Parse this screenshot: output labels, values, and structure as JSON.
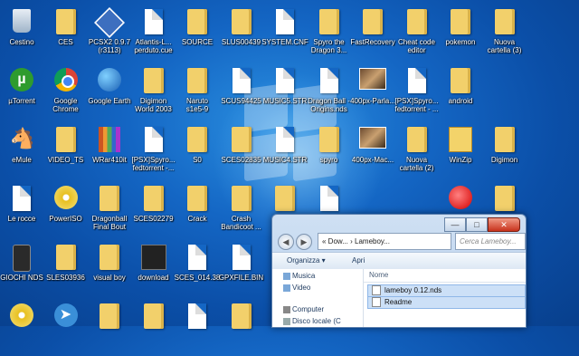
{
  "desktop": {
    "icons": [
      {
        "label": "Cestino",
        "kind": "bin",
        "col": 0,
        "row": 0
      },
      {
        "label": "CES",
        "kind": "folder",
        "col": 1,
        "row": 0
      },
      {
        "label": "PCSX2 0.9.7\n(r3113)",
        "kind": "blueapp",
        "col": 2,
        "row": 0
      },
      {
        "label": "Atlantis-L...\nperduto.cue",
        "kind": "file",
        "col": 3,
        "row": 0
      },
      {
        "label": "SOURCE",
        "kind": "folder",
        "col": 4,
        "row": 0
      },
      {
        "label": "SLUS00439",
        "kind": "folder",
        "col": 5,
        "row": 0
      },
      {
        "label": "SYSTEM.CNF",
        "kind": "file",
        "col": 6,
        "row": 0
      },
      {
        "label": "Spyro the\nDragon 3...",
        "kind": "folder",
        "col": 7,
        "row": 0
      },
      {
        "label": "FastRecovery",
        "kind": "folder",
        "col": 8,
        "row": 0
      },
      {
        "label": "Cheat code\neditor",
        "kind": "folder",
        "col": 9,
        "row": 0
      },
      {
        "label": "pokemon",
        "kind": "folder",
        "col": 10,
        "row": 0
      },
      {
        "label": "Nuova\ncartella (3)",
        "kind": "folder",
        "col": 11,
        "row": 0
      },
      {
        "label": "µTorrent",
        "kind": "utorrent",
        "col": 0,
        "row": 1
      },
      {
        "label": "Google\nChrome",
        "kind": "chrome",
        "col": 1,
        "row": 1
      },
      {
        "label": "Google Earth",
        "kind": "globe",
        "col": 2,
        "row": 1
      },
      {
        "label": "Digimon\nWorld 2003",
        "kind": "folder",
        "col": 3,
        "row": 1
      },
      {
        "label": "Naruto\ns1e5-9",
        "kind": "folder",
        "col": 4,
        "row": 1
      },
      {
        "label": "SCUS94425",
        "kind": "file",
        "col": 5,
        "row": 1
      },
      {
        "label": "MUSIC5.STR",
        "kind": "file",
        "col": 6,
        "row": 1
      },
      {
        "label": "Dragon Ball -\nOrigins.nds",
        "kind": "file",
        "col": 7,
        "row": 1
      },
      {
        "label": "400px-Parla...",
        "kind": "thumb",
        "col": 8,
        "row": 1
      },
      {
        "label": "[PSX]Spyro...\nfedtorrent - ...",
        "kind": "file",
        "col": 9,
        "row": 1
      },
      {
        "label": "android",
        "kind": "folder",
        "col": 10,
        "row": 1
      },
      {
        "label": "eMule",
        "kind": "mule",
        "col": 0,
        "row": 2
      },
      {
        "label": "VIDEO_TS",
        "kind": "folder",
        "col": 1,
        "row": 2
      },
      {
        "label": "WRar410it",
        "kind": "stack",
        "col": 2,
        "row": 2
      },
      {
        "label": "[PSX]Spyro...\nfedtorrent -...",
        "kind": "file",
        "col": 3,
        "row": 2
      },
      {
        "label": "S0",
        "kind": "folder",
        "col": 4,
        "row": 2
      },
      {
        "label": "SCES02835",
        "kind": "folder",
        "col": 5,
        "row": 2
      },
      {
        "label": "MUSIC4.STR",
        "kind": "file",
        "col": 6,
        "row": 2
      },
      {
        "label": "spyro",
        "kind": "folder",
        "col": 7,
        "row": 2
      },
      {
        "label": "400px-Mac...",
        "kind": "thumb",
        "col": 8,
        "row": 2
      },
      {
        "label": "Nuova\ncartella (2)",
        "kind": "folder",
        "col": 9,
        "row": 2
      },
      {
        "label": "WinZip",
        "kind": "zip",
        "col": 10,
        "row": 2
      },
      {
        "label": "Digimon",
        "kind": "folder",
        "col": 11,
        "row": 2
      },
      {
        "label": "Le rocce",
        "kind": "file",
        "col": 0,
        "row": 3
      },
      {
        "label": "PowerISO",
        "kind": "disc",
        "col": 1,
        "row": 3
      },
      {
        "label": "Dragonball\nFinal Bout",
        "kind": "folder",
        "col": 2,
        "row": 3
      },
      {
        "label": "SCES02279",
        "kind": "folder",
        "col": 3,
        "row": 3
      },
      {
        "label": "Crack",
        "kind": "folder",
        "col": 4,
        "row": 3
      },
      {
        "label": "Crash\nBandicoot ...",
        "kind": "folder",
        "col": 5,
        "row": 3
      },
      {
        "label": "",
        "kind": "folder",
        "col": 6,
        "row": 3
      },
      {
        "label": "",
        "kind": "file",
        "col": 7,
        "row": 3
      },
      {
        "label": "",
        "kind": "redball",
        "col": 10,
        "row": 3
      },
      {
        "label": "",
        "kind": "folder",
        "col": 11,
        "row": 3
      },
      {
        "label": "GIOCHI NDS",
        "kind": "device",
        "col": 0,
        "row": 4
      },
      {
        "label": "SLES03936",
        "kind": "folder",
        "col": 1,
        "row": 4
      },
      {
        "label": "visual boy",
        "kind": "folder",
        "col": 2,
        "row": 4
      },
      {
        "label": "download",
        "kind": "dark",
        "col": 3,
        "row": 4
      },
      {
        "label": "SCES_014.38",
        "kind": "file",
        "col": 4,
        "row": 4
      },
      {
        "label": "GPXFILE.BIN",
        "kind": "file",
        "col": 5,
        "row": 4
      },
      {
        "label": "",
        "kind": "file",
        "col": 6,
        "row": 4
      },
      {
        "label": "",
        "kind": "disc",
        "col": 0,
        "row": 5
      },
      {
        "label": "",
        "kind": "speed",
        "col": 1,
        "row": 5
      },
      {
        "label": "",
        "kind": "folder",
        "col": 2,
        "row": 5
      },
      {
        "label": "",
        "kind": "folder",
        "col": 3,
        "row": 5
      },
      {
        "label": "",
        "kind": "file",
        "col": 4,
        "row": 5
      },
      {
        "label": "",
        "kind": "folder",
        "col": 5,
        "row": 5
      }
    ]
  },
  "explorer": {
    "address": "«  Dow...  ›  Lameboy...",
    "search_placeholder": "Cerca Lameboy...",
    "toolbar": {
      "organize": "Organizza ▾",
      "open": "Apri"
    },
    "nav": [
      {
        "label": "Musica",
        "color": "#7aa7d8"
      },
      {
        "label": "Video",
        "color": "#7aa7d8"
      },
      {
        "label": "Computer",
        "color": "#888"
      },
      {
        "label": "Disco locale (C",
        "color": "#9aa"
      }
    ],
    "column_name": "Nome",
    "files": [
      {
        "name": "lameboy 0.12.nds",
        "suffix": "1"
      },
      {
        "name": "Readme",
        "suffix": "1"
      }
    ],
    "controls": {
      "minimize": "—",
      "maximize": "□",
      "close": "✕"
    }
  }
}
